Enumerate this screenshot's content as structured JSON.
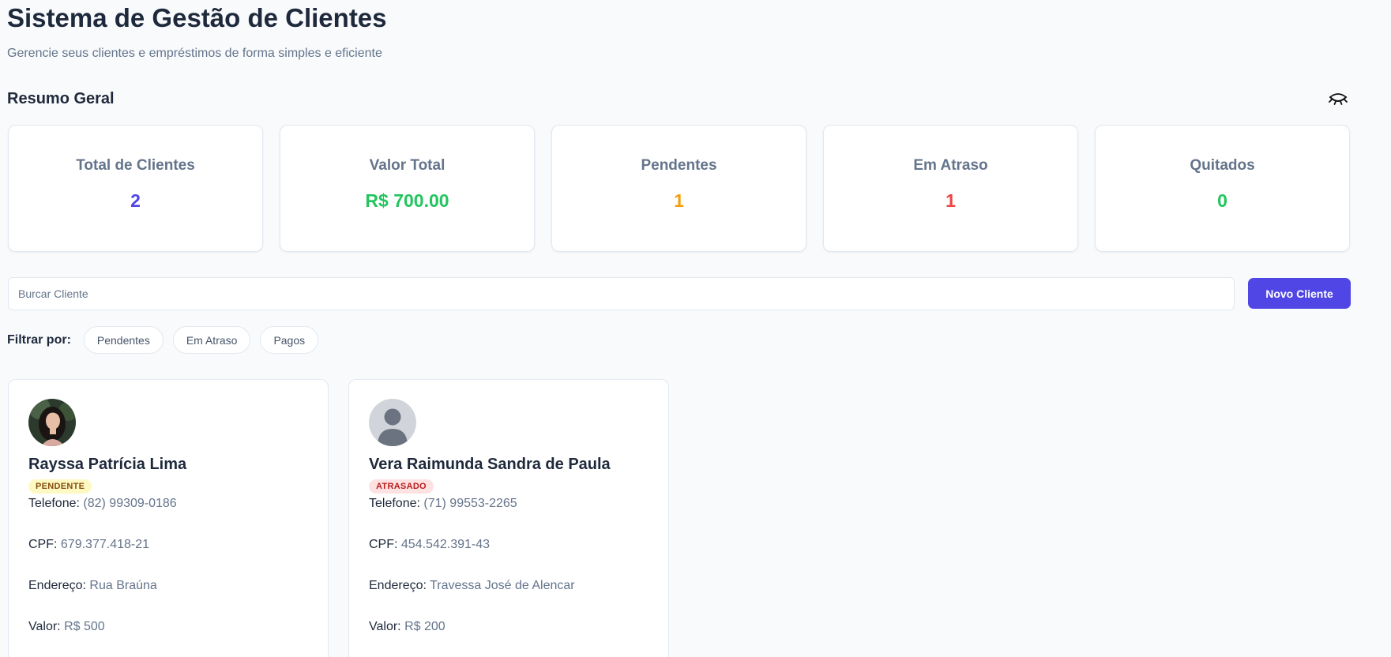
{
  "header": {
    "title": "Sistema de Gestão de Clientes",
    "subtitle": "Gerencie seus clientes e empréstimos de forma simples e eficiente"
  },
  "summary": {
    "title": "Resumo Geral",
    "toggle_icon": "eye-closed-icon",
    "cards": [
      {
        "label": "Total de Clientes",
        "value": "2",
        "color": "#4f46e5"
      },
      {
        "label": "Valor Total",
        "value": "R$ 700.00",
        "color": "#22c55e"
      },
      {
        "label": "Pendentes",
        "value": "1",
        "color": "#f59e0b"
      },
      {
        "label": "Em Atraso",
        "value": "1",
        "color": "#ef4444"
      },
      {
        "label": "Quitados",
        "value": "0",
        "color": "#22c55e"
      }
    ]
  },
  "search": {
    "placeholder": "Burcar Cliente",
    "value": ""
  },
  "actions": {
    "new_client_label": "Novo Cliente"
  },
  "filters": {
    "label": "Filtrar por:",
    "options": [
      "Pendentes",
      "Em Atraso",
      "Pagos"
    ]
  },
  "clients": [
    {
      "name": "Rayssa Patrícia Lima",
      "status": "PENDENTE",
      "phone_label": "Telefone:",
      "phone": "(82) 99309-0186",
      "cpf_label": "CPF:",
      "cpf": "679.377.418-21",
      "address_label": "Endereço:",
      "address": "Rua Braúna",
      "value_label": "Valor:",
      "value": "R$ 500"
    },
    {
      "name": "Vera Raimunda Sandra de Paula",
      "status": "ATRASADO",
      "phone_label": "Telefone:",
      "phone": "(71) 99553-2265",
      "cpf_label": "CPF:",
      "cpf": "454.542.391-43",
      "address_label": "Endereço:",
      "address": "Travessa José de Alencar",
      "value_label": "Valor:",
      "value": "R$ 200"
    }
  ],
  "colors": {
    "accent": "#4f46e5",
    "pending_bg": "#fef9c3",
    "pending_text": "#854d0e",
    "late_bg": "#fee2e2",
    "late_text": "#b91c1c"
  }
}
